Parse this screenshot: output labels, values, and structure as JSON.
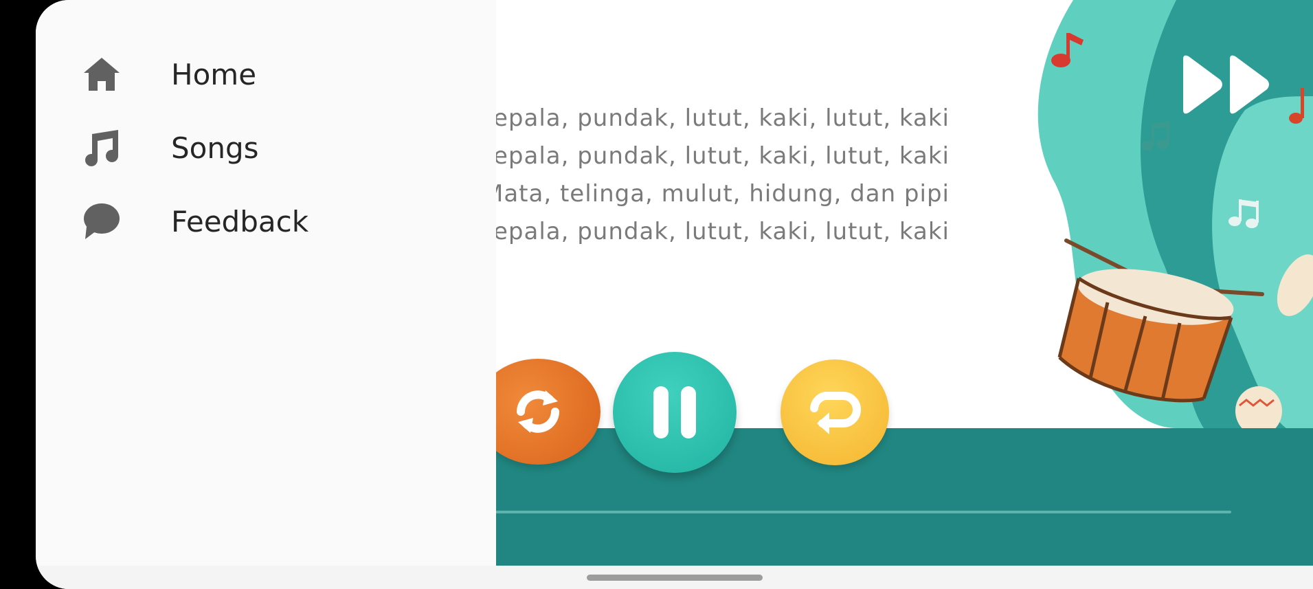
{
  "lyrics": [
    "Kepala, pundak, lutut, kaki, lutut, kaki",
    "Kepala, pundak, lutut, kaki, lutut, kaki",
    "Mata, telinga, mulut, hidung, dan pipi",
    "Kepala, pundak, lutut, kaki, lutut, kaki"
  ],
  "player": {
    "state": "playing",
    "progress": 0
  },
  "drawer": {
    "items": [
      {
        "label": "Home",
        "icon": "home-icon"
      },
      {
        "label": "Songs",
        "icon": "music-note-icon"
      },
      {
        "label": "Feedback",
        "icon": "chat-bubble-icon"
      }
    ]
  },
  "colors": {
    "teal_dark": "#218681",
    "teal_button": "#2bbfab",
    "orange_button": "#e8772a",
    "yellow_button": "#f8c440",
    "drawer_bg": "#fafafa",
    "icon_gray": "#616161"
  }
}
